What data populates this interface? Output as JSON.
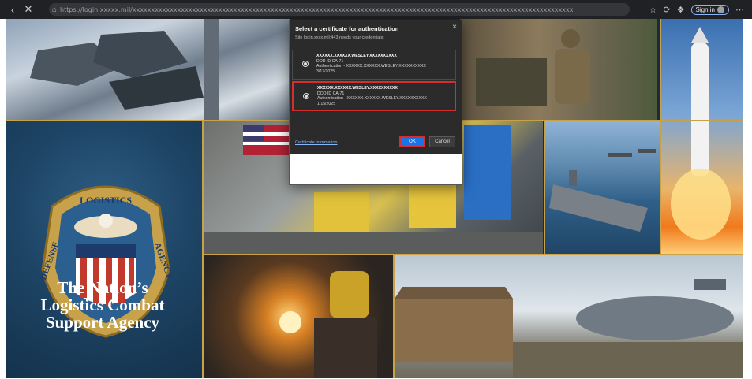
{
  "browser": {
    "url": "https://login.xxxxx.mil/xxxxxxxxxxxxxxxxxxxxxxxxxxxxxxxxxxxxxxxxxxxxxxxxxxxxxxxxxxxxxxxxxxxxxxxxxxxxxxxxxxxxxxxxxxxxxxxxxxxxxxxxxxxxxxxxxxxxxx",
    "sign_in_label": "Sign in"
  },
  "page": {
    "tagline": [
      "The Nation’s",
      "Logistics Combat",
      "Support Agency"
    ],
    "seal": {
      "top_text": "LOGISTICS",
      "left_text": "DEFENSE",
      "right_text": "AGENCY"
    },
    "colors": {
      "gold": "#c8a24a",
      "navy": "#1e4566"
    }
  },
  "dialog": {
    "title": "Select a certificate for authentication",
    "subtitle": "Site login.xxxx.mil:443 needs your credentials:",
    "close_label": "×",
    "certificates": [
      {
        "name": "XXXXXX.XXXXXX.WESLEY.XXXXXXXXXX",
        "issuer": "DOD ID CA-71",
        "purpose": "Authentication - XXXXXX.XXXXXX.WESLEY.XXXXXXXXXX",
        "date": "3/17/2025"
      },
      {
        "name": "XXXXXX.XXXXXX.WESLEY.XXXXXXXXXX",
        "issuer": "DOD ID CA-71",
        "purpose": "Authentication - XXXXXX.XXXXXX.WESLEY.XXXXXXXXXX",
        "date": "1/15/2025"
      }
    ],
    "cert_info_link": "Certificate information",
    "ok_label": "OK",
    "cancel_label": "Cancel"
  }
}
